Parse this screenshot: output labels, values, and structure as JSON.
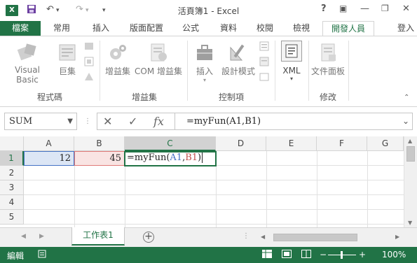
{
  "app": {
    "title": "活頁簿1 - Excel",
    "logo_text": "X",
    "quick_access": {
      "save": "💾",
      "undo": "↶",
      "redo": "↷",
      "more": "▾"
    },
    "window_buttons": {
      "help": "?",
      "ribbon_options": "▣",
      "minimize": "—",
      "restore": "❐",
      "close": "✕"
    }
  },
  "ribbon_tabs": [
    "檔案",
    "常用",
    "插入",
    "版面配置",
    "公式",
    "資料",
    "校閱",
    "檢視",
    "開發人員"
  ],
  "signin": "登入",
  "ribbon": {
    "code": {
      "group": "程式碼",
      "visual_basic": "Visual Basic",
      "macros": "巨集"
    },
    "addins": {
      "group": "增益集",
      "addins": "增益集",
      "com_addins": "COM 增益集"
    },
    "controls": {
      "group": "控制項",
      "insert": "插入",
      "design_mode": "設計模式"
    },
    "xml": {
      "group": "",
      "label": "XML"
    },
    "modify": {
      "group": "修改",
      "doc_panel": "文件面板"
    }
  },
  "formula_bar": {
    "name_box": "SUM",
    "cancel": "✕",
    "enter": "✓",
    "fx": "fx",
    "formula": "=myFun(A1,B1)"
  },
  "grid": {
    "columns": [
      "A",
      "B",
      "C",
      "D",
      "E",
      "F",
      "G"
    ],
    "rows": [
      "1",
      "2",
      "3",
      "4",
      "5"
    ],
    "a1": "12",
    "b1": "45",
    "c1_editing": {
      "prefix": "=myFun(",
      "ref1": "A1",
      "comma": ",",
      "ref2": "B1",
      "suffix": ")"
    }
  },
  "sheet_tabs": {
    "active": "工作表1",
    "add": "+"
  },
  "status": {
    "mode": "編輯",
    "zoom": "100%",
    "zoom_minus": "−",
    "zoom_plus": "+"
  },
  "colors": {
    "accent": "#217346",
    "ref_a1": "#4472c4",
    "ref_b1": "#c0504d"
  }
}
